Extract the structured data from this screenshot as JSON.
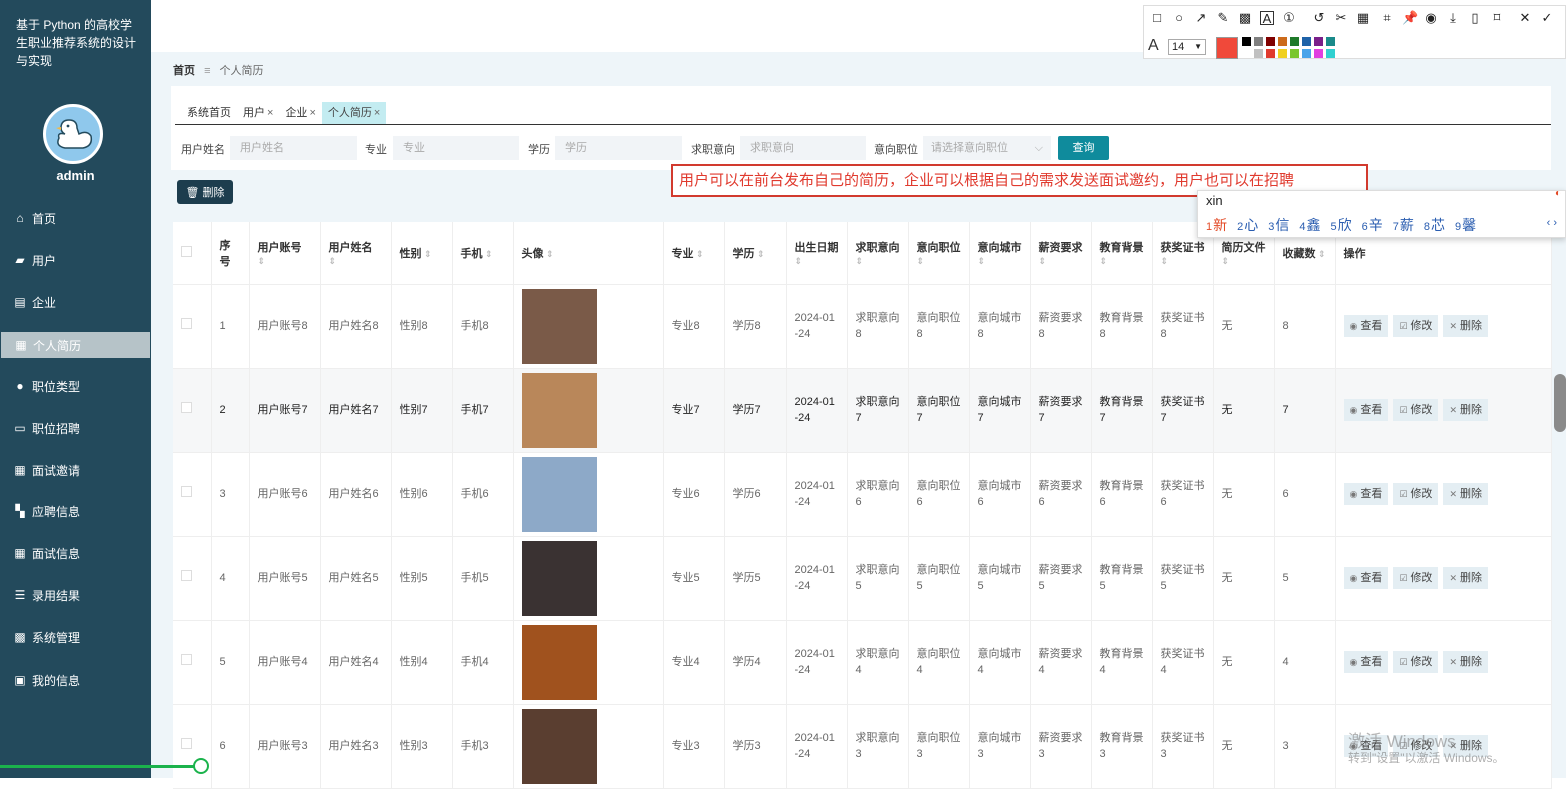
{
  "app": {
    "title": "基于 Python 的高校学生职业推荐系统的设计与实现",
    "user": "admin"
  },
  "menu": [
    {
      "label": "首页",
      "icon": "home-icon"
    },
    {
      "label": "用户",
      "icon": "briefcase-icon"
    },
    {
      "label": "企业",
      "icon": "clipboard-icon"
    },
    {
      "label": "个人简历",
      "icon": "grid-icon",
      "active": true
    },
    {
      "label": "职位类型",
      "icon": "user-icon"
    },
    {
      "label": "职位招聘",
      "icon": "monitor-icon"
    },
    {
      "label": "面试邀请",
      "icon": "grid-icon"
    },
    {
      "label": "应聘信息",
      "icon": "film-icon"
    },
    {
      "label": "面试信息",
      "icon": "grid-icon"
    },
    {
      "label": "录用结果",
      "icon": "list-icon"
    },
    {
      "label": "系统管理",
      "icon": "apps-icon"
    },
    {
      "label": "我的信息",
      "icon": "card-icon"
    }
  ],
  "breadcrumb": {
    "home": "首页",
    "sep": "≡",
    "current": "个人简历"
  },
  "tabs": [
    {
      "label": "系统首页",
      "closable": false
    },
    {
      "label": "用户",
      "closable": true
    },
    {
      "label": "企业",
      "closable": true
    },
    {
      "label": "个人简历",
      "closable": true,
      "active": true
    }
  ],
  "filters": [
    {
      "label": "用户姓名",
      "placeholder": "用户姓名"
    },
    {
      "label": "专业",
      "placeholder": "专业"
    },
    {
      "label": "学历",
      "placeholder": "学历"
    },
    {
      "label": "求职意向",
      "placeholder": "求职意向"
    },
    {
      "label": "意向职位",
      "placeholder": "请选择意向职位"
    }
  ],
  "query_label": "查询",
  "delete_label": "删除",
  "annotation_text": "用户可以在前台发布自己的简历，企业可以根据自己的需求发送面试邀约，用户也可以在招聘",
  "ime": {
    "pinyin": "xin",
    "candidates": [
      "新",
      "心",
      "信",
      "鑫",
      "欣",
      "辛",
      "薪",
      "芯",
      "馨"
    ]
  },
  "table": {
    "headers": [
      "序号",
      "用户账号",
      "用户姓名",
      "性别",
      "手机",
      "头像",
      "专业",
      "学历",
      "出生日期",
      "求职意向",
      "意向职位",
      "意向城市",
      "薪资要求",
      "教育背景",
      "获奖证书",
      "简历文件",
      "收藏数",
      "操作"
    ],
    "rows": [
      {
        "no": "1",
        "account": "用户账号8",
        "name": "用户姓名8",
        "gender": "性别8",
        "phone": "手机8",
        "major": "专业8",
        "edu": "学历8",
        "birth": "2024-01-24",
        "intent": "求职意向8",
        "position": "意向职位8",
        "city": "意向城市8",
        "salary": "薪资要求8",
        "background": "教育背景8",
        "award": "获奖证书8",
        "file": "无",
        "fav": "8",
        "photo": "#7a5a48"
      },
      {
        "no": "2",
        "account": "用户账号7",
        "name": "用户姓名7",
        "gender": "性别7",
        "phone": "手机7",
        "major": "专业7",
        "edu": "学历7",
        "birth": "2024-01-24",
        "intent": "求职意向7",
        "position": "意向职位7",
        "city": "意向城市7",
        "salary": "薪资要求7",
        "background": "教育背景7",
        "award": "获奖证书7",
        "file": "无",
        "fav": "7",
        "photo": "#b9875a",
        "hl": true
      },
      {
        "no": "3",
        "account": "用户账号6",
        "name": "用户姓名6",
        "gender": "性别6",
        "phone": "手机6",
        "major": "专业6",
        "edu": "学历6",
        "birth": "2024-01-24",
        "intent": "求职意向6",
        "position": "意向职位6",
        "city": "意向城市6",
        "salary": "薪资要求6",
        "background": "教育背景6",
        "award": "获奖证书6",
        "file": "无",
        "fav": "6",
        "photo": "#8da9c8"
      },
      {
        "no": "4",
        "account": "用户账号5",
        "name": "用户姓名5",
        "gender": "性别5",
        "phone": "手机5",
        "major": "专业5",
        "edu": "学历5",
        "birth": "2024-01-24",
        "intent": "求职意向5",
        "position": "意向职位5",
        "city": "意向城市5",
        "salary": "薪资要求5",
        "background": "教育背景5",
        "award": "获奖证书5",
        "file": "无",
        "fav": "5",
        "photo": "#3a3232"
      },
      {
        "no": "5",
        "account": "用户账号4",
        "name": "用户姓名4",
        "gender": "性别4",
        "phone": "手机4",
        "major": "专业4",
        "edu": "学历4",
        "birth": "2024-01-24",
        "intent": "求职意向4",
        "position": "意向职位4",
        "city": "意向城市4",
        "salary": "薪资要求4",
        "background": "教育背景4",
        "award": "获奖证书4",
        "file": "无",
        "fav": "4",
        "photo": "#a0521e"
      },
      {
        "no": "6",
        "account": "用户账号3",
        "name": "用户姓名3",
        "gender": "性别3",
        "phone": "手机3",
        "major": "专业3",
        "edu": "学历3",
        "birth": "2024-01-24",
        "intent": "求职意向3",
        "position": "意向职位3",
        "city": "意向城市3",
        "salary": "薪资要求3",
        "background": "教育背景3",
        "award": "获奖证书3",
        "file": "无",
        "fav": "3",
        "photo": "#5a3e30"
      }
    ],
    "actions": {
      "view": "查看",
      "edit": "修改",
      "delete": "删除"
    }
  },
  "toolbar": {
    "font_size": "14",
    "current_color": "#f0493a",
    "palette": [
      "#000000",
      "#808080",
      "#800000",
      "#cc6b1b",
      "#1f7a2a",
      "#1e62a8",
      "#7a1f8a",
      "#1a8a8a",
      "#ffffff",
      "#c0c0c0",
      "#e03a2e",
      "#f0d020",
      "#7ac62e",
      "#4aa4ea",
      "#e040e0",
      "#30d0d0"
    ]
  },
  "watermark": {
    "line1": "激活 Windows",
    "line2": "转到\"设置\"以激活 Windows。"
  }
}
